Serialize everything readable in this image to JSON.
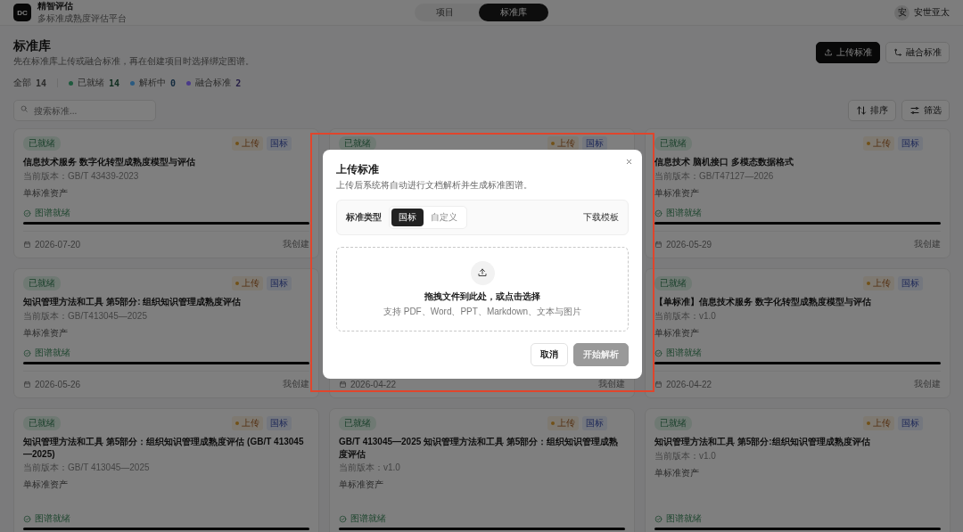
{
  "header": {
    "logo": "DC",
    "app_name": "精智评估",
    "app_subtitle": "多标准成熟度评估平台",
    "tabs": [
      {
        "label": "项目",
        "selected": false
      },
      {
        "label": "标准库",
        "selected": true
      }
    ],
    "user": {
      "avatar": "安",
      "name": "安世亚太"
    }
  },
  "page": {
    "title": "标准库",
    "subtitle": "先在标准库上传或融合标准，再在创建项目时选择绑定图谱。",
    "actions": [
      {
        "label": "上传标准",
        "kind": "primary"
      },
      {
        "label": "融合标准",
        "kind": "secondary"
      }
    ]
  },
  "stats": {
    "total_label": "全部",
    "total": "14",
    "items": [
      {
        "label": "已就绪",
        "count": "14",
        "color": "#1f5a3e"
      },
      {
        "label": "解析中",
        "count": "0",
        "color": "#2a5a80"
      },
      {
        "label": "融合标准",
        "count": "2",
        "color": "#4a3a8a"
      }
    ]
  },
  "search": {
    "placeholder": "搜索标准..."
  },
  "tools": [
    {
      "label": "排序",
      "kind": "sort"
    },
    {
      "label": "筛选",
      "kind": "filter"
    }
  ],
  "cards": [
    {
      "status": "已就绪",
      "tags": [
        {
          "label": "上传",
          "kind": "source"
        },
        {
          "label": "国标",
          "kind": "type"
        }
      ],
      "title": "信息技术服务 数字化转型成熟度模型与评估",
      "version": "当前版本：GB/T 43439-2023",
      "asset": "单标准资产",
      "graph_status": "图谱就绪",
      "level": 1,
      "date": "2026-07-20",
      "creator": "我创建"
    },
    {
      "status": "已就绪",
      "tags": [
        {
          "label": "上传",
          "kind": "source"
        },
        {
          "label": "国标",
          "kind": "type"
        }
      ]
    },
    {
      "status": "已就绪",
      "tags": [
        {
          "label": "上传",
          "kind": "source"
        },
        {
          "label": "国标",
          "kind": "type"
        }
      ],
      "title": "信息技术 脑机接口 多模态数据格式",
      "version": "当前版本：GB/T47127—2026",
      "asset": "单标准资产",
      "graph_status": "图谱就绪",
      "level": 1,
      "date": "2026-05-29",
      "creator": "我创建"
    },
    {
      "status": "已就绪",
      "tags": [
        {
          "label": "上传",
          "kind": "source"
        },
        {
          "label": "国标",
          "kind": "type"
        }
      ],
      "title": "知识管理方法和工具 第5部分: 组织知识管理成熟度评估",
      "version": "当前版本：GB/T413045—2025",
      "asset": "单标准资产",
      "graph_status": "图谱就绪",
      "level": 1,
      "date": "2026-05-26",
      "creator": "我创建"
    },
    {
      "date": "2026-04-22",
      "creator": "我创建"
    },
    {
      "status": "已就绪",
      "tags": [
        {
          "label": "上传",
          "kind": "source"
        },
        {
          "label": "国标",
          "kind": "type"
        }
      ],
      "title": "【单标准】信息技术服务 数字化转型成熟度模型与评估",
      "version": "当前版本：v1.0",
      "asset": "单标准资产",
      "graph_status": "图谱就绪",
      "level": 1,
      "date": "2026-04-22",
      "creator": "我创建"
    },
    {
      "status": "已就绪",
      "tags": [
        {
          "label": "上传",
          "kind": "source"
        },
        {
          "label": "国标",
          "kind": "type"
        }
      ],
      "title": "知识管理方法和工具 第5部分：组织知识管理成熟度评估 (GB/T 413045—2025)",
      "version": "当前版本：GB/T 413045—2025",
      "asset": "单标准资产",
      "graph_status": "图谱就绪",
      "level": 1
    },
    {
      "status": "已就绪",
      "tags": [
        {
          "label": "上传",
          "kind": "source"
        },
        {
          "label": "国标",
          "kind": "type"
        }
      ],
      "title": "GB/T 413045—2025 知识管理方法和工具 第5部分：组织知识管理成熟度评估",
      "version": "当前版本：v1.0",
      "asset": "单标准资产",
      "graph_status": "图谱就绪",
      "level": 1
    },
    {
      "status": "已就绪",
      "tags": [
        {
          "label": "上传",
          "kind": "source"
        },
        {
          "label": "国标",
          "kind": "type"
        }
      ],
      "title": "知识管理方法和工具 第5部分:组织知识管理成熟度评估",
      "version": "当前版本：v1.0",
      "asset": "单标准资产",
      "graph_status": "图谱就绪",
      "level": 1
    }
  ],
  "modal": {
    "title": "上传标准",
    "subtitle": "上传后系统将自动进行文档解析并生成标准图谱。",
    "type_label": "标准类型",
    "type_options": [
      {
        "label": "国标",
        "selected": true
      },
      {
        "label": "自定义",
        "selected": false
      }
    ],
    "template_link": "下载模板",
    "drop_title": "拖拽文件到此处，或点击选择",
    "drop_hint": "支持 PDF、Word、PPT、Markdown、文本与图片",
    "buttons": [
      {
        "label": "取消",
        "kind": "secondary",
        "disabled": false
      },
      {
        "label": "开始解析",
        "kind": "primary",
        "disabled": true
      }
    ]
  }
}
